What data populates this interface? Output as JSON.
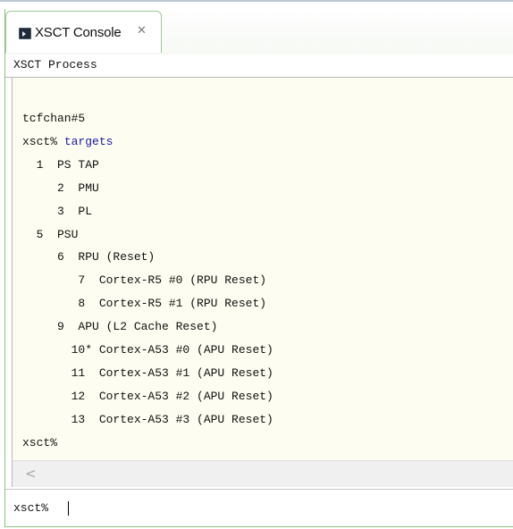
{
  "tab": {
    "icon": "terminal-icon",
    "label": "XSCT Console",
    "close_glyph": "✕"
  },
  "process": {
    "label": "XSCT Process"
  },
  "console": {
    "lines": [
      {
        "prompt": "tcfchan#5",
        "command": ""
      },
      {
        "prompt": "xsct% ",
        "command": "targets"
      },
      {
        "prompt": "  1  PS TAP",
        "command": ""
      },
      {
        "prompt": "     2  PMU",
        "command": ""
      },
      {
        "prompt": "     3  PL",
        "command": ""
      },
      {
        "prompt": "  5  PSU",
        "command": ""
      },
      {
        "prompt": "     6  RPU (Reset)",
        "command": ""
      },
      {
        "prompt": "        7  Cortex-R5 #0 (RPU Reset)",
        "command": ""
      },
      {
        "prompt": "        8  Cortex-R5 #1 (RPU Reset)",
        "command": ""
      },
      {
        "prompt": "     9  APU (L2 Cache Reset)",
        "command": ""
      },
      {
        "prompt": "       10* Cortex-A53 #0 (APU Reset)",
        "command": ""
      },
      {
        "prompt": "       11  Cortex-A53 #1 (APU Reset)",
        "command": ""
      },
      {
        "prompt": "       12  Cortex-A53 #2 (APU Reset)",
        "command": ""
      },
      {
        "prompt": "       13  Cortex-A53 #3 (APU Reset)",
        "command": ""
      },
      {
        "prompt": "xsct%",
        "command": ""
      }
    ]
  },
  "scrollbar": {
    "left_arrow": "<"
  },
  "input": {
    "prompt": "xsct%"
  },
  "colors": {
    "console_bg": "#fdfdf1",
    "command": "#1a1aa6",
    "tab_border": "#9ec89a"
  }
}
